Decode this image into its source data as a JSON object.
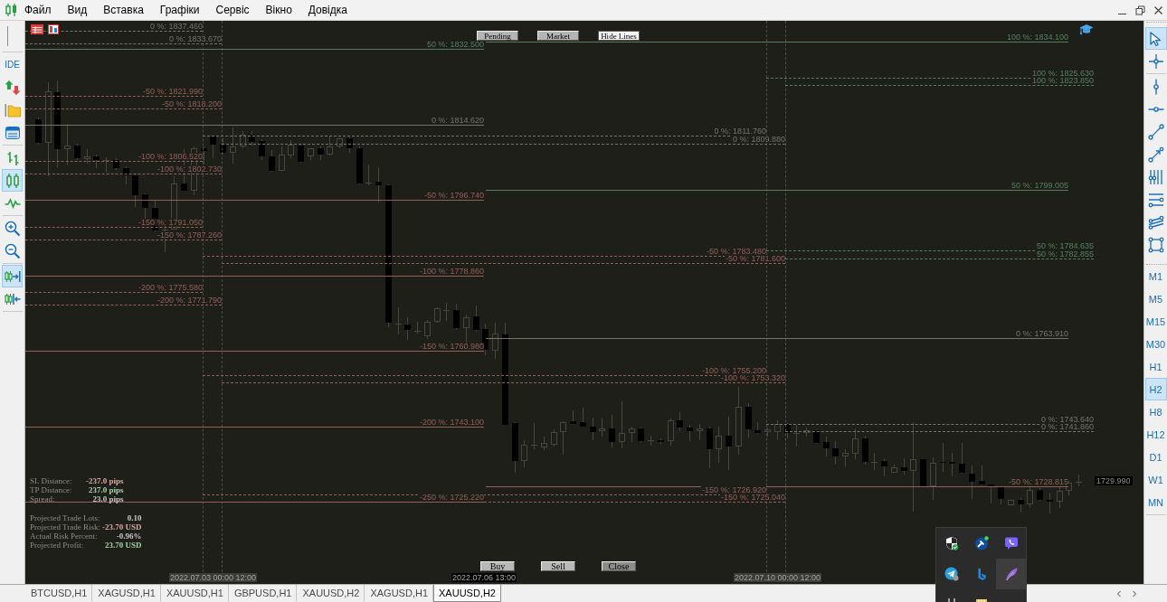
{
  "menu_bar": {
    "items": [
      "Файл",
      "Вид",
      "Вставка",
      "Графіки",
      "Сервіс",
      "Вікно",
      "Довідка"
    ]
  },
  "left_toolbar": {
    "groups": [
      {
        "items": [
          {
            "kind": "ide",
            "label": "IDE",
            "selected": false
          },
          {
            "kind": "algo_trading",
            "selected": false
          },
          {
            "kind": "folder",
            "selected": false
          },
          {
            "kind": "panel",
            "selected": false
          }
        ]
      },
      {
        "items": [
          {
            "kind": "bars",
            "selected": false
          },
          {
            "kind": "candles",
            "selected": true
          },
          {
            "kind": "line",
            "selected": false
          }
        ]
      },
      {
        "items": [
          {
            "kind": "zoom_in",
            "selected": false
          },
          {
            "kind": "zoom_out",
            "selected": false
          }
        ]
      },
      {
        "items": [
          {
            "kind": "autoscroll",
            "selected": true
          },
          {
            "kind": "chart_shift",
            "selected": false
          }
        ]
      }
    ]
  },
  "chart": {
    "top_buttons": [
      {
        "label": "Pending",
        "color": "#b4b4b4"
      },
      {
        "label": "Market",
        "color": "#b4b4b4"
      },
      {
        "label": "Hide Lines",
        "color": "#f4f4f4"
      }
    ],
    "fib_sets": [
      {
        "dashed": true,
        "levels": [
          {
            "label": "0 %: 1837.460",
            "color": "#74746d"
          },
          {
            "label": "-50 %: 1821.990",
            "color": "#935f59"
          },
          {
            "label": "-100 %: 1806.520",
            "color": "#935f59"
          },
          {
            "label": "-150 %: 1791.050",
            "color": "#935f59"
          },
          {
            "label": "-200 %: 1775.580",
            "color": "#935f59"
          }
        ]
      },
      {
        "dashed": true,
        "levels": [
          {
            "label": "0 %: 1833.670",
            "color": "#74746d"
          },
          {
            "label": "-50 %: 1818.200",
            "color": "#935f59"
          },
          {
            "label": "-100 %: 1802.730",
            "color": "#935f59"
          },
          {
            "label": "-150 %: 1787.260",
            "color": "#935f59"
          },
          {
            "label": "-200 %: 1771.790",
            "color": "#935f59"
          }
        ]
      },
      {
        "dashed": false,
        "levels": [
          {
            "label": "50 %: 1832.500",
            "color": "#52805e"
          },
          {
            "label": "0 %: 1814.620",
            "color": "#74746d"
          },
          {
            "label": "-50 %: 1796.740",
            "color": "#935f59"
          },
          {
            "label": "-100 %: 1778.860",
            "color": "#935f59"
          },
          {
            "label": "-150 %: 1760.980",
            "color": "#935f59"
          },
          {
            "label": "-200 %: 1743.100",
            "color": "#935f59"
          },
          {
            "label": "-250 %: 1725.220",
            "color": "#935f59"
          }
        ]
      },
      {
        "dashed": false,
        "levels": [
          {
            "label": "100 %: 1834.100",
            "color": "#52805e"
          },
          {
            "label": "50 %: 1799.005",
            "color": "#52805e"
          },
          {
            "label": "0 %: 1763.910",
            "color": "#74746d"
          },
          {
            "label": "-50 %: 1728.815",
            "color": "#935f59"
          }
        ]
      },
      {
        "dashed": true,
        "levels": [
          {
            "label": "0 %: 1811.760",
            "color": "#74746d"
          },
          {
            "label": "-50 %: 1783.480",
            "color": "#935f59"
          },
          {
            "label": "-100 %: 1755.200",
            "color": "#935f59"
          },
          {
            "label": "-150 %: 1726.920",
            "color": "#935f59"
          }
        ]
      },
      {
        "dashed": true,
        "levels": [
          {
            "label": "0 %: 1809.880",
            "color": "#74746d"
          },
          {
            "label": "-50 %: 1781.600",
            "color": "#935f59"
          },
          {
            "label": "-100 %: 1753.320",
            "color": "#935f59"
          },
          {
            "label": "-150 %: 1725.040",
            "color": "#935f59"
          }
        ]
      },
      {
        "dashed": true,
        "levels": [
          {
            "label": "100 %: 1825.630",
            "color": "#52805e"
          },
          {
            "label": "50 %: 1784.635",
            "color": "#52805e"
          },
          {
            "label": "0 %: 1743.640",
            "color": "#74746d"
          }
        ]
      },
      {
        "dashed": true,
        "levels": [
          {
            "label": "100 %: 1823.850",
            "color": "#52805e"
          },
          {
            "label": "50 %: 1782.855",
            "color": "#52805e"
          },
          {
            "label": "0 %: 1741.860",
            "color": "#74746d"
          }
        ]
      }
    ],
    "info_panel": {
      "groups": [
        {
          "rows": [
            {
              "label": "SL Distance:",
              "value": "-237.0 pips",
              "color": "#d9a3a3"
            },
            {
              "label": "TP Distance:",
              "value": "237.0 pips",
              "color": "#a3d3a3"
            },
            {
              "label": "Spread:",
              "value": "23.0 pips",
              "color": "#c4c4c4"
            }
          ]
        },
        {
          "rows": [
            {
              "label": "Projected Trade Lots:",
              "value": "0.10",
              "color": "#c4c4c4"
            },
            {
              "label": "Projected Trade Risk:",
              "value": "-23.70 USD",
              "color": "#d9a3a3"
            },
            {
              "label": "Actual Risk Percent:",
              "value": "-0.96%",
              "color": "#c4c4c4"
            },
            {
              "label": "Projected Profit:",
              "value": "23.70 USD",
              "color": "#a3d3a3"
            }
          ]
        }
      ]
    },
    "trade_buttons": [
      {
        "label": "Buy",
        "color": "#b8b8b8"
      },
      {
        "label": "Sell",
        "color": "#b8b8b8"
      },
      {
        "label": "Close",
        "color": "#8c8c8c"
      }
    ],
    "time_labels": [
      {
        "text": "2022.07.03 00:00 12:00",
        "color": "#3c3c38"
      },
      {
        "text": "2022.07.06 13:00",
        "color": "#000000"
      },
      {
        "text": "2022.07.10 00:00 12:00",
        "color": "#3c3c38"
      }
    ],
    "price_label": "1729.990"
  },
  "right_toolbar": {
    "tool_groups": [
      {
        "items": [
          {
            "kind": "cursor",
            "selected": true
          },
          {
            "kind": "crosshair",
            "selected": false
          }
        ]
      },
      {
        "items": [
          {
            "kind": "vertical_line",
            "selected": false
          },
          {
            "kind": "horizontal_line",
            "selected": false
          },
          {
            "kind": "trend_line",
            "selected": false
          },
          {
            "kind": "arrow_line",
            "selected": false
          },
          {
            "kind": "cycle_lines",
            "selected": false
          },
          {
            "kind": "horizontal_lines",
            "selected": false
          },
          {
            "kind": "channel",
            "selected": false
          },
          {
            "kind": "rectangle",
            "selected": false
          }
        ]
      }
    ],
    "timeframes": [
      {
        "label": "M1",
        "selected": false
      },
      {
        "label": "M5",
        "selected": false
      },
      {
        "label": "M15",
        "selected": false
      },
      {
        "label": "M30",
        "selected": false
      },
      {
        "label": "H1",
        "selected": false
      },
      {
        "label": "H2",
        "selected": true
      },
      {
        "label": "H8",
        "selected": false
      },
      {
        "label": "H12",
        "selected": false
      },
      {
        "label": "D1",
        "selected": false
      },
      {
        "label": "W1",
        "selected": false
      },
      {
        "label": "MN",
        "selected": false
      }
    ]
  },
  "tab_bar": {
    "tabs": [
      {
        "label": "BTCUSD,H1",
        "selected": false
      },
      {
        "label": "XAGUSD,H1",
        "selected": false
      },
      {
        "label": "XAUUSD,H1",
        "selected": false
      },
      {
        "label": "GBPUSD,H1",
        "selected": false
      },
      {
        "label": "XAUUSD,H2",
        "selected": false
      },
      {
        "label": "XAGUSD,H1",
        "selected": false
      },
      {
        "label": "XAUUSD,H2",
        "selected": true
      }
    ]
  },
  "tray_popup": {
    "items": [
      {
        "kind": "shield",
        "hovered": false
      },
      {
        "kind": "hammer",
        "hovered": false
      },
      {
        "kind": "phone_bubble",
        "hovered": false
      },
      {
        "kind": "paper_plane",
        "hovered": false
      },
      {
        "kind": "logo",
        "hovered": false
      },
      {
        "kind": "feather",
        "hovered": true
      },
      {
        "kind": "plug",
        "hovered": false
      },
      {
        "kind": "box",
        "hovered": false
      }
    ]
  }
}
